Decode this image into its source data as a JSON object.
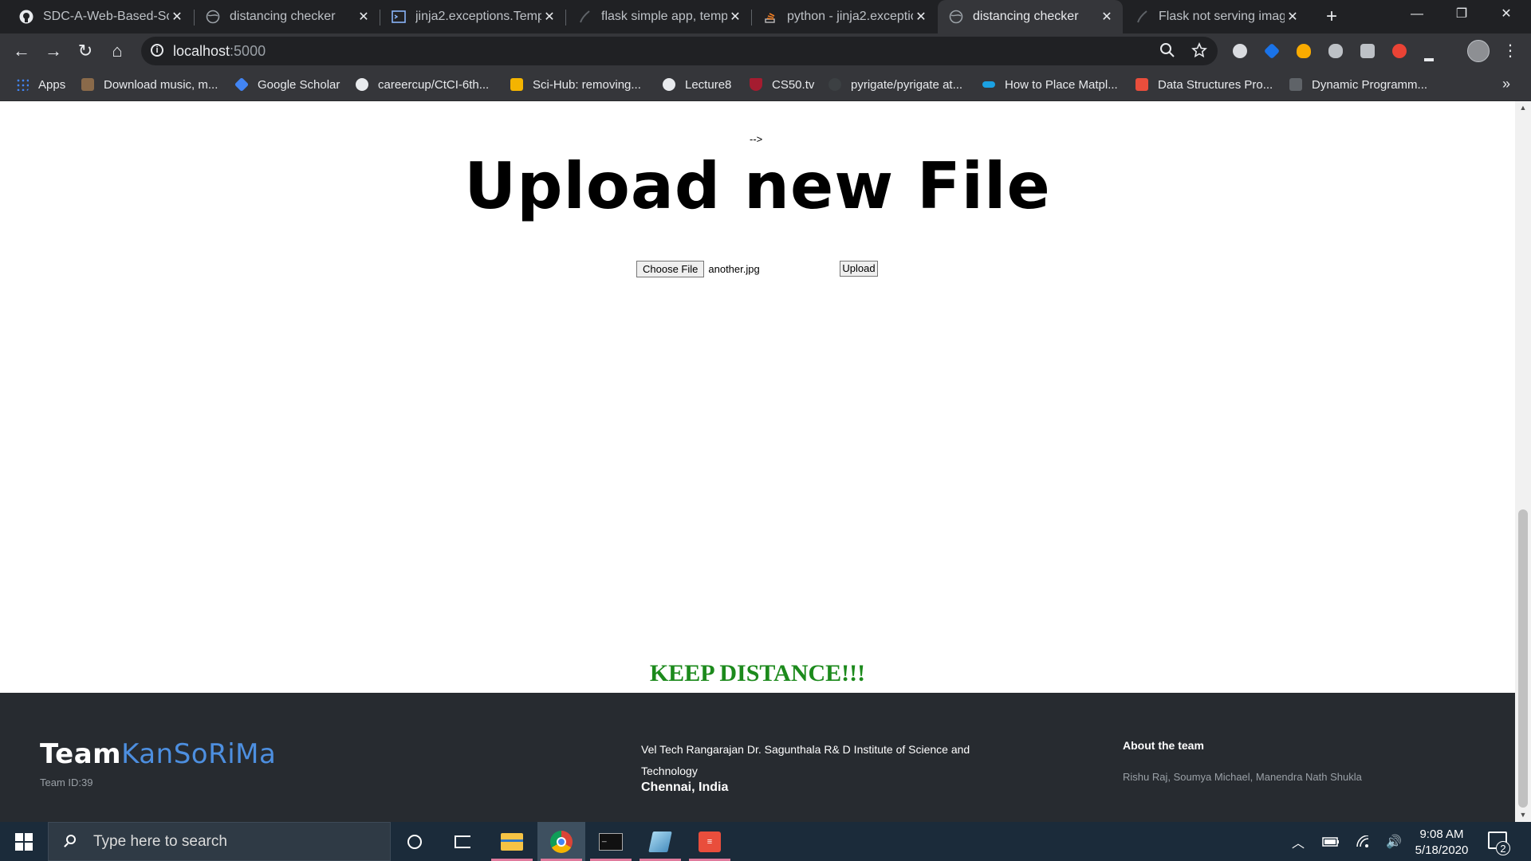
{
  "browser": {
    "tabs": [
      {
        "title": "SDC-A-Web-Based-Sol",
        "icon": "github-icon"
      },
      {
        "title": "distancing checker",
        "icon": "globe-icon"
      },
      {
        "title": "jinja2.exceptions.Templ",
        "icon": "terminal-icon"
      },
      {
        "title": "flask simple app, templ",
        "icon": "flask-icon"
      },
      {
        "title": "python - jinja2.exceptic",
        "icon": "stackoverflow-icon"
      },
      {
        "title": "distancing checker",
        "icon": "globe-icon",
        "active": true
      },
      {
        "title": "Flask not serving imag",
        "icon": "flask-icon"
      }
    ],
    "new_tab": "+",
    "window_controls": {
      "minimize": "—",
      "restore": "❐",
      "close": "✕"
    },
    "toolbar": {
      "back": "←",
      "forward": "→",
      "reload": "↻",
      "home": "⌂",
      "url_host": "localhost",
      "url_port": ":5000",
      "zoom_icon": "magnifier-icon",
      "star_icon": "bookmark-star-icon",
      "menu": "⋮"
    },
    "bookmarks": [
      {
        "label": "Apps",
        "icon": "apps-grid-icon",
        "color": "#4285f4"
      },
      {
        "label": "Download music, m...",
        "icon": "music-icon",
        "color": "#8a6a4a"
      },
      {
        "label": "Google Scholar",
        "icon": "scholar-icon",
        "color": "#4285f4"
      },
      {
        "label": "careercup/CtCI-6th...",
        "icon": "github-icon",
        "color": "#e8eaed"
      },
      {
        "label": "Sci-Hub: removing...",
        "icon": "scihub-icon",
        "color": "#f4b400"
      },
      {
        "label": "Lecture8",
        "icon": "globe-icon",
        "color": "#e8eaed"
      },
      {
        "label": "CS50.tv",
        "icon": "harvard-shield-icon",
        "color": "#a51c30"
      },
      {
        "label": "pyrigate/pyrigate at...",
        "icon": "github-icon",
        "color": "#e8eaed"
      },
      {
        "label": "How to Place Matpl...",
        "icon": "matplotlib-icon",
        "color": "#1ba1e2"
      },
      {
        "label": "Data Structures Pro...",
        "icon": "geeks-icon",
        "color": "#e94e3c"
      },
      {
        "label": "Dynamic Programm...",
        "icon": "page-icon",
        "color": "#5f6368"
      }
    ],
    "bookmarks_more": "»"
  },
  "page": {
    "comment_tail": "-->",
    "heading": "Upload new File",
    "choose_file_label": "Choose File",
    "file_name": "another.jpg",
    "upload_label": "Upload",
    "tagline": "KEEP DISTANCE!!!"
  },
  "footer": {
    "brand_part1": "Team",
    "brand_part2": "KanSoRiMa",
    "team_id": "Team ID:39",
    "institution": "Vel Tech Rangarajan Dr. Sagunthala R& D Institute of Science and Technology",
    "city": "Chennai, India",
    "about_heading": "About the team",
    "members": "Rishu Raj, Soumya Michael, Manendra Nath Shukla"
  },
  "taskbar": {
    "search_placeholder": "Type here to search",
    "time": "9:08 AM",
    "date": "5/18/2020",
    "notification_count": "2",
    "tray_chevron": "︿",
    "volume": "🔊"
  },
  "colors": {
    "tagline": "#1c8a1c",
    "brand_accent": "#4d8fe0",
    "footer_bg": "#272b30",
    "browser_dark": "#202124"
  }
}
